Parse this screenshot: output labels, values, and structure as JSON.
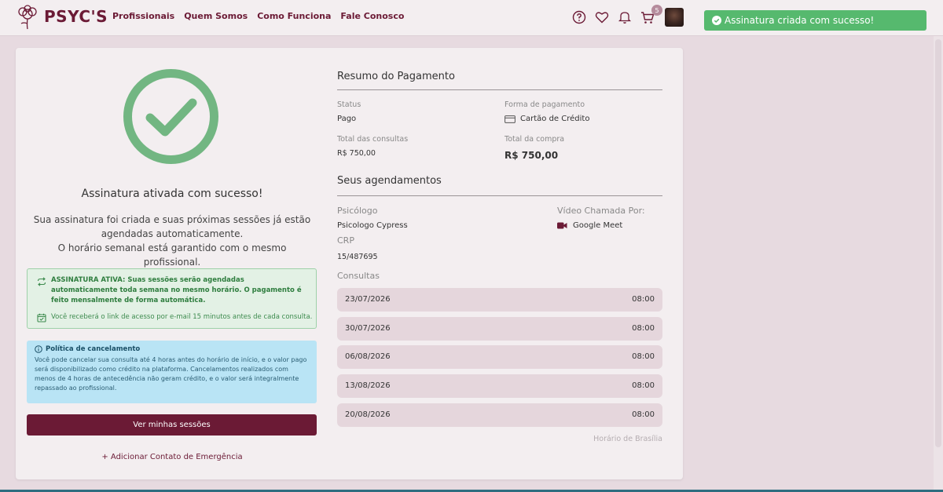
{
  "brand": {
    "name": "PSYC'S",
    "accent": "#6b1a35"
  },
  "nav": [
    "Profissionais",
    "Quem Somos",
    "Como Funciona",
    "Fale Conosco"
  ],
  "header_icons": [
    "help-icon",
    "heart-icon",
    "bell-icon",
    "cart-icon"
  ],
  "cart_count": "5",
  "toast": {
    "text": "Assinatura criada com sucesso!",
    "color": "#56b96e"
  },
  "success": {
    "title": "Assinatura ativada com sucesso!",
    "desc_line1": "Sua assinatura foi criada e suas próximas sessões já estão",
    "desc_line2": "agendadas automaticamente.",
    "desc_line3": "O horário semanal está garantido com o mesmo profissional."
  },
  "subscription_box": {
    "strong": "ASSINATURA ATIVA: Suas sessões serão agendadas automaticamente toda semana no mesmo horário. O pagamento é feito mensalmente de forma automática.",
    "note": "Você receberá o link de acesso por e-mail 15 minutos antes de cada consulta."
  },
  "cancel_policy": {
    "title": "Política de cancelamento",
    "text": "Você pode cancelar sua consulta até 4 horas antes do horário de início, e o valor pago será disponibilizado como crédito na plataforma. Cancelamentos realizados com menos de 4 horas de antecedência não geram crédito, e o valor será integralmente repassado ao profissional."
  },
  "actions": {
    "primary": "Ver minhas sessões",
    "emergency": "+ Adicionar Contato de Emergência"
  },
  "payment": {
    "title": "Resumo do Pagamento",
    "status_label": "Status",
    "status_value": "Pago",
    "method_label": "Forma de pagamento",
    "method_value": "Cartão de Crédito",
    "consults_label": "Total das consultas",
    "consults_value": "R$ 750,00",
    "total_label": "Total da compra",
    "total_value": "R$ 750,00"
  },
  "appointments": {
    "title": "Seus agendamentos",
    "psych_label": "Psicólogo",
    "psych_value": "Psicologo Cypress",
    "crp_label": "CRP",
    "crp_value": "15/487695",
    "video_label": "Vídeo Chamada Por:",
    "video_value": "Google Meet",
    "consults_label": "Consultas",
    "list": [
      {
        "date": "23/07/2026",
        "time": "08:00"
      },
      {
        "date": "30/07/2026",
        "time": "08:00"
      },
      {
        "date": "06/08/2026",
        "time": "08:00"
      },
      {
        "date": "13/08/2026",
        "time": "08:00"
      },
      {
        "date": "20/08/2026",
        "time": "08:00"
      }
    ],
    "timezone": "Horário de Brasília"
  }
}
